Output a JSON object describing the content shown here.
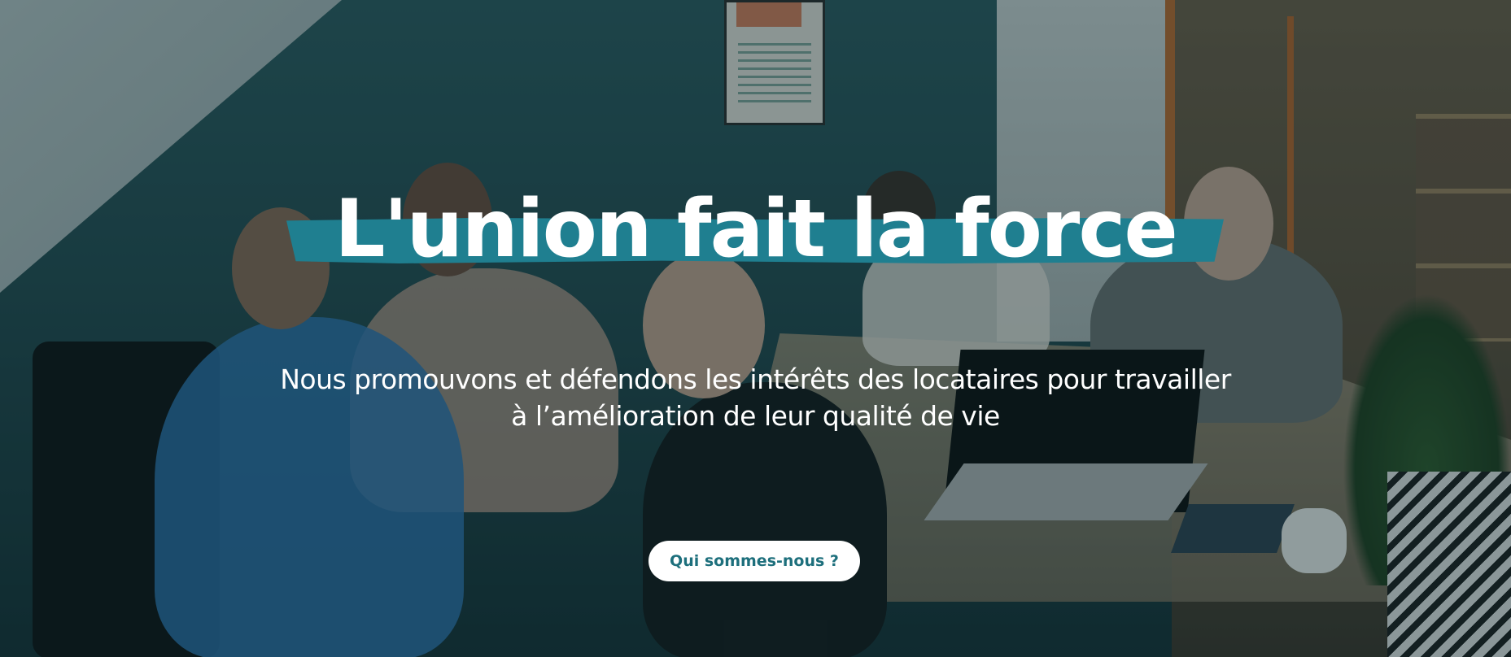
{
  "hero": {
    "headline": "L'union fait la force",
    "subtitle_line1": "Nous promouvons et défendons les intérêts des locataires pour travailler",
    "subtitle_line2": "à l’amélioration de leur qualité de vie",
    "cta_label": "Qui sommes-nous ?"
  },
  "colors": {
    "accent": "#1f7f90",
    "cta_text": "#1d6f7c",
    "text": "#ffffff"
  }
}
